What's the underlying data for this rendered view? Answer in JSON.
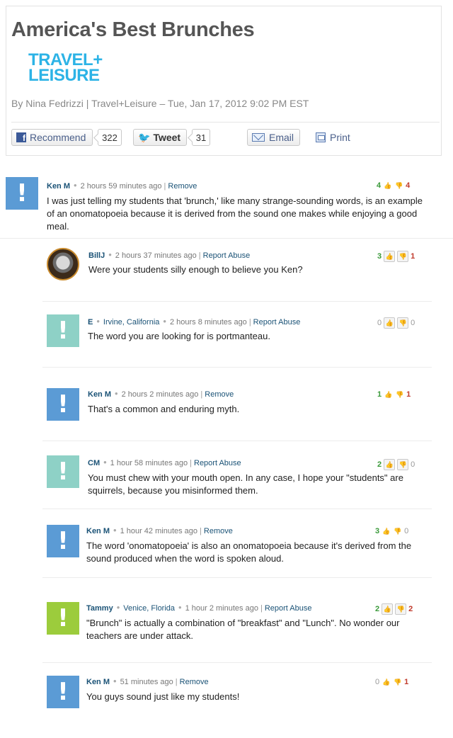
{
  "article": {
    "title": "America's Best Brunches",
    "logo_line1": "TRAVEL+",
    "logo_line2": "LEISURE",
    "byline": "By Nina Fedrizzi | Travel+Leisure – Tue, Jan 17, 2012 9:02 PM EST"
  },
  "share": {
    "recommend_label": "Recommend",
    "recommend_count": "322",
    "tweet_label": "Tweet",
    "tweet_count": "31",
    "email_label": "Email",
    "print_label": "Print"
  },
  "comments": [
    {
      "user": "Ken M",
      "location": "",
      "time": "2 hours 59 minutes ago",
      "action": "Remove",
      "text": "I was just telling my students that 'brunch,' like many strange-sounding words, is an example of an onomatopoeia because it is derived from the sound one makes while enjoying a good meal.",
      "up": "4",
      "down": "4",
      "avatar_color": "#5b9bd5"
    },
    {
      "user": "BillJ",
      "location": "",
      "time": "2 hours 37 minutes ago",
      "action": "Report Abuse",
      "text": "Were your students silly enough to believe you Ken?",
      "up": "3",
      "down": "1",
      "avatar_color": "#c98a2c"
    },
    {
      "user": "E",
      "location": "Irvine, California",
      "time": "2 hours 8 minutes ago",
      "action": "Report Abuse",
      "text": "The word you are looking for is portmanteau.",
      "up": "0",
      "down": "0",
      "avatar_color": "#8ed1c6"
    },
    {
      "user": "Ken M",
      "location": "",
      "time": "2 hours 2 minutes ago",
      "action": "Remove",
      "text": "That's a common and enduring myth.",
      "up": "1",
      "down": "1",
      "avatar_color": "#5b9bd5"
    },
    {
      "user": "CM",
      "location": "",
      "time": "1 hour 58 minutes ago",
      "action": "Report Abuse",
      "text": "You must chew with your mouth open. In any case, I hope your \"students\" are squirrels, because you misinformed them.",
      "up": "2",
      "down": "0",
      "avatar_color": "#8ed1c6"
    },
    {
      "user": "Ken M",
      "location": "",
      "time": "1 hour 42 minutes ago",
      "action": "Remove",
      "text": "The word 'onomatopoeia' is also an onomatopoeia because it's derived from the sound produced when the word is spoken aloud.",
      "up": "3",
      "down": "0",
      "avatar_color": "#5b9bd5"
    },
    {
      "user": "Tammy",
      "location": "Venice, Florida",
      "time": "1 hour 2 minutes ago",
      "action": "Report Abuse",
      "text": "\"Brunch\" is actually a combination of \"breakfast\" and \"Lunch\". No wonder our teachers are under attack.",
      "up": "2",
      "down": "2",
      "avatar_color": "#9ccc3c"
    },
    {
      "user": "Ken M",
      "location": "",
      "time": "51 minutes ago",
      "action": "Remove",
      "text": "You guys sound just like my students!",
      "up": "0",
      "down": "1",
      "avatar_color": "#5b9bd5"
    }
  ]
}
